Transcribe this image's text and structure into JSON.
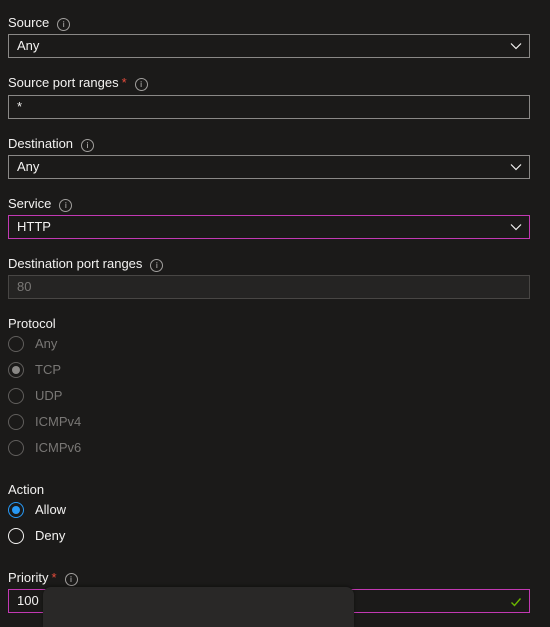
{
  "source": {
    "label": "Source",
    "value": "Any"
  },
  "source_port_ranges": {
    "label": "Source port ranges",
    "required": "*",
    "value": "*"
  },
  "destination": {
    "label": "Destination",
    "value": "Any"
  },
  "service": {
    "label": "Service",
    "value": "HTTP"
  },
  "destination_port_ranges": {
    "label": "Destination port ranges",
    "value": "80"
  },
  "protocol": {
    "label": "Protocol",
    "options": [
      "Any",
      "TCP",
      "UDP",
      "ICMPv4",
      "ICMPv6"
    ],
    "selected": "TCP"
  },
  "action": {
    "label": "Action",
    "options": [
      "Allow",
      "Deny"
    ],
    "selected": "Allow"
  },
  "priority": {
    "label": "Priority",
    "required": "*",
    "value": "100"
  },
  "icons": {
    "info": "info-icon",
    "chevron": "chevron-down-icon",
    "valid": "checkmark-icon"
  },
  "colors": {
    "background": "#1b1a19",
    "focus_border": "#c239b3",
    "radio_selected": "#2899f5",
    "required": "#e74c3c",
    "valid_check": "#6bb700"
  }
}
